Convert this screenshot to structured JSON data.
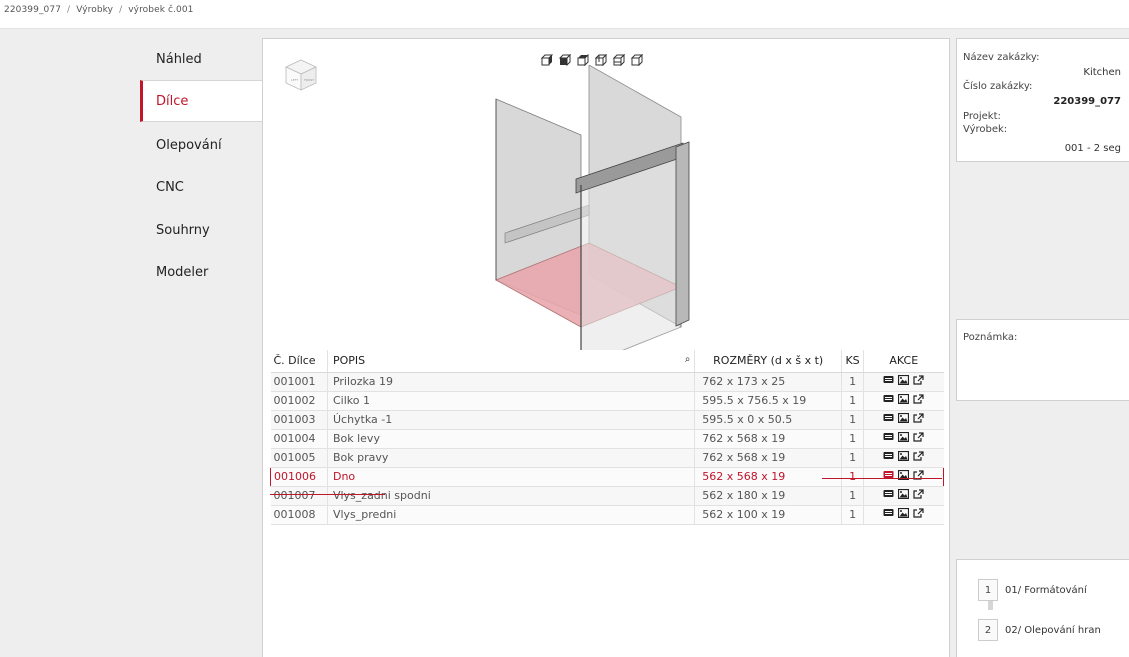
{
  "breadcrumb": {
    "items": [
      "220399_077",
      "Výrobky",
      "výrobek č.001"
    ],
    "separator": "/"
  },
  "nav": {
    "items": [
      {
        "label": "Náhled"
      },
      {
        "label": "Dílce"
      },
      {
        "label": "Olepování"
      },
      {
        "label": "CNC"
      },
      {
        "label": "Souhrny"
      },
      {
        "label": "Modeler"
      }
    ],
    "active": "Dílce"
  },
  "viewer": {
    "view_buttons": [
      "view-front-icon",
      "view-back-icon",
      "view-left-icon",
      "view-right-icon",
      "view-top-icon",
      "view-bottom-icon"
    ],
    "nav_cube_icon": "nav-cube-icon"
  },
  "table": {
    "headers": {
      "code": "Č. Dílce",
      "desc": "POPIS",
      "dims": "ROZMĚRY (d x š x t)",
      "ks": "KS",
      "actions": "AKCE"
    },
    "rows": [
      {
        "code": "001001",
        "desc": "Prilozka 19",
        "dims": "762 x 173 x 25",
        "ks": "1"
      },
      {
        "code": "001002",
        "desc": "Cilko 1",
        "dims": "595.5 x 756.5 x 19",
        "ks": "1"
      },
      {
        "code": "001003",
        "desc": "Úchytka -1",
        "dims": "595.5 x 0 x 50.5",
        "ks": "1"
      },
      {
        "code": "001004",
        "desc": "Bok levy",
        "dims": "762 x 568 x 19",
        "ks": "1"
      },
      {
        "code": "001005",
        "desc": "Bok pravy",
        "dims": "762 x 568 x 19",
        "ks": "1"
      },
      {
        "code": "001006",
        "desc": "Dno",
        "dims": "562 x 568 x 19",
        "ks": "1"
      },
      {
        "code": "001007",
        "desc": "Vlys_zadni spodni",
        "dims": "562 x 180 x 19",
        "ks": "1"
      },
      {
        "code": "001008",
        "desc": "Vlys_predni",
        "dims": "562 x 100 x 19",
        "ks": "1"
      }
    ],
    "selected_code": "001006",
    "action_icons": [
      "monitor-icon",
      "image-icon",
      "external-link-icon"
    ]
  },
  "info": {
    "order_name_label": "Název zakázky:",
    "order_name_value": "Kitchen",
    "order_number_label": "Číslo zakázky:",
    "order_number_value": "220399_077",
    "project_label": "Projekt:",
    "product_label": "Výrobek:",
    "product_value": "001 - 2 seg"
  },
  "note": {
    "label": "Poznámka:"
  },
  "operations": [
    {
      "num": "1",
      "label": "01/ Formátování"
    },
    {
      "num": "2",
      "label": "02/ Olepování hran"
    }
  ],
  "colors": {
    "accent": "#c0152a",
    "panel_bg": "#eeeeee",
    "highlight_part": "#e8a8ad"
  }
}
